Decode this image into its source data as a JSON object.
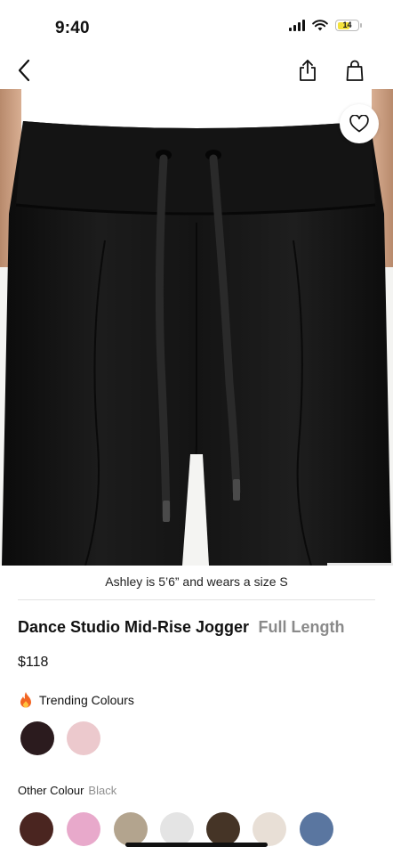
{
  "status_bar": {
    "time": "9:40",
    "battery_level": "14",
    "icons": [
      "signal-icon",
      "wifi-icon",
      "battery-icon"
    ]
  },
  "nav": {
    "back_icon": "chevron-left-icon",
    "share_icon": "share-icon",
    "bag_icon": "shopping-bag-icon"
  },
  "product": {
    "wishlist_icon": "heart-icon",
    "model_caption": "Ashley is 5’6” and wears a size S",
    "name": "Dance Studio Mid-Rise Jogger",
    "length": "Full Length",
    "price": "$118"
  },
  "trending": {
    "label": "Trending Colours",
    "icon": "fire-icon",
    "swatches": [
      "#2b1b1e",
      "#ecc9cd"
    ]
  },
  "other_colours": {
    "label": "Other Colour",
    "selected": "Black",
    "swatches": [
      "#4a2520",
      "#e8a9cb",
      "#b3a48e",
      "#e4e4e4",
      "#453426",
      "#e8dfd6",
      "#5a76a0"
    ]
  }
}
